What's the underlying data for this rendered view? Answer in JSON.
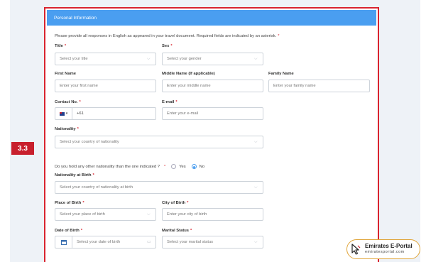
{
  "step_number": "3.3",
  "section_title": "Personal Information",
  "intro_text": "Please provide all responses in English as appeared in your travel document. Required fields are indicated by an asterisk.",
  "required_marker": "*",
  "fields": {
    "title": {
      "label": "Title",
      "placeholder": "Select your title"
    },
    "sex": {
      "label": "Sex",
      "placeholder": "Select your gender"
    },
    "first_name": {
      "label": "First Name",
      "placeholder": "Enter your first name"
    },
    "middle_name": {
      "label": "Middle Name (If applicable)",
      "placeholder": "Enter your middle name"
    },
    "family_name": {
      "label": "Family Name",
      "placeholder": "Enter your family name"
    },
    "contact_no": {
      "label": "Contact No.",
      "value": "+61"
    },
    "email": {
      "label": "E-mail",
      "placeholder": "Enter your e-mail"
    },
    "nationality": {
      "label": "Nationality",
      "placeholder": "Select your country of nationality"
    },
    "other_nationality": {
      "question": "Do you hold any other nationality than the one indicated ?",
      "options": [
        "Yes",
        "No"
      ],
      "selected": "No"
    },
    "nationality_at_birth": {
      "label": "Nationality at Birth",
      "placeholder": "Select your country of nationality at birth"
    },
    "place_of_birth": {
      "label": "Place of Birth",
      "placeholder": "Select your place of birth"
    },
    "city_of_birth": {
      "label": "City of Birth",
      "placeholder": "Enter your city of birth"
    },
    "date_of_birth": {
      "label": "Date of Birth",
      "placeholder": "Select your date of birth"
    },
    "marital_status": {
      "label": "Marital Status",
      "placeholder": "Select your marital status"
    }
  },
  "watermark": {
    "title": "Emirates E-Portal",
    "subtitle": "emiratesportal.com"
  },
  "colors": {
    "header": "#4a9ef0",
    "frame": "#d9232f",
    "badge": "#c8202d",
    "required": "#d9232f"
  }
}
